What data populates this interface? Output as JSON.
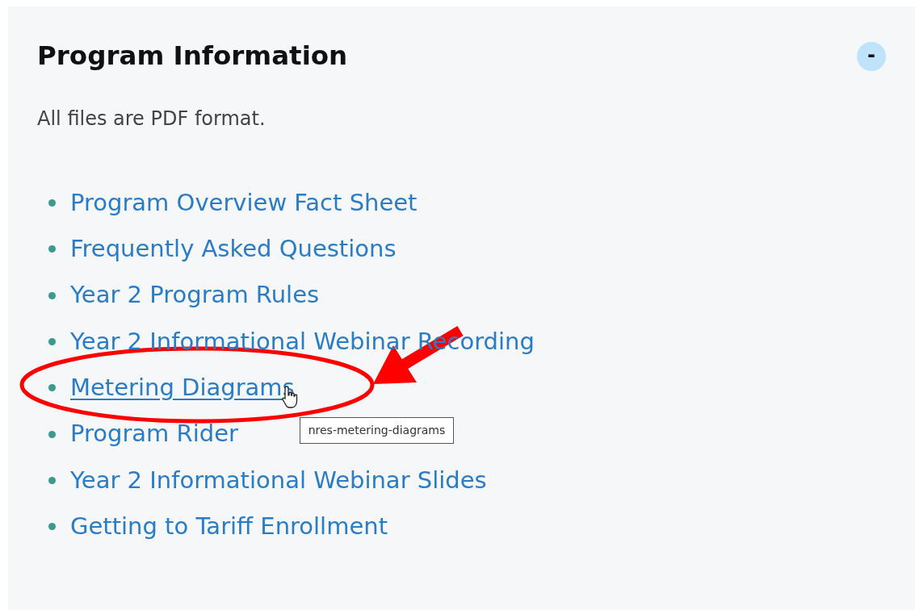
{
  "panel": {
    "title": "Program Information",
    "toggle": "-",
    "expanded": true
  },
  "note": "All files are PDF format.",
  "links": [
    {
      "label": "Program Overview Fact Sheet",
      "hovered": false
    },
    {
      "label": "Frequently Asked Questions",
      "hovered": false
    },
    {
      "label": "Year 2 Program Rules",
      "hovered": false
    },
    {
      "label": "Year 2 Informational Webinar Recording",
      "hovered": false
    },
    {
      "label": "Metering Diagrams",
      "hovered": true,
      "tooltip": "nres-metering-diagrams"
    },
    {
      "label": "Program Rider",
      "hovered": false
    },
    {
      "label": "Year 2 Informational Webinar Slides",
      "hovered": false
    },
    {
      "label": "Getting to Tariff Enrollment",
      "hovered": false
    }
  ]
}
